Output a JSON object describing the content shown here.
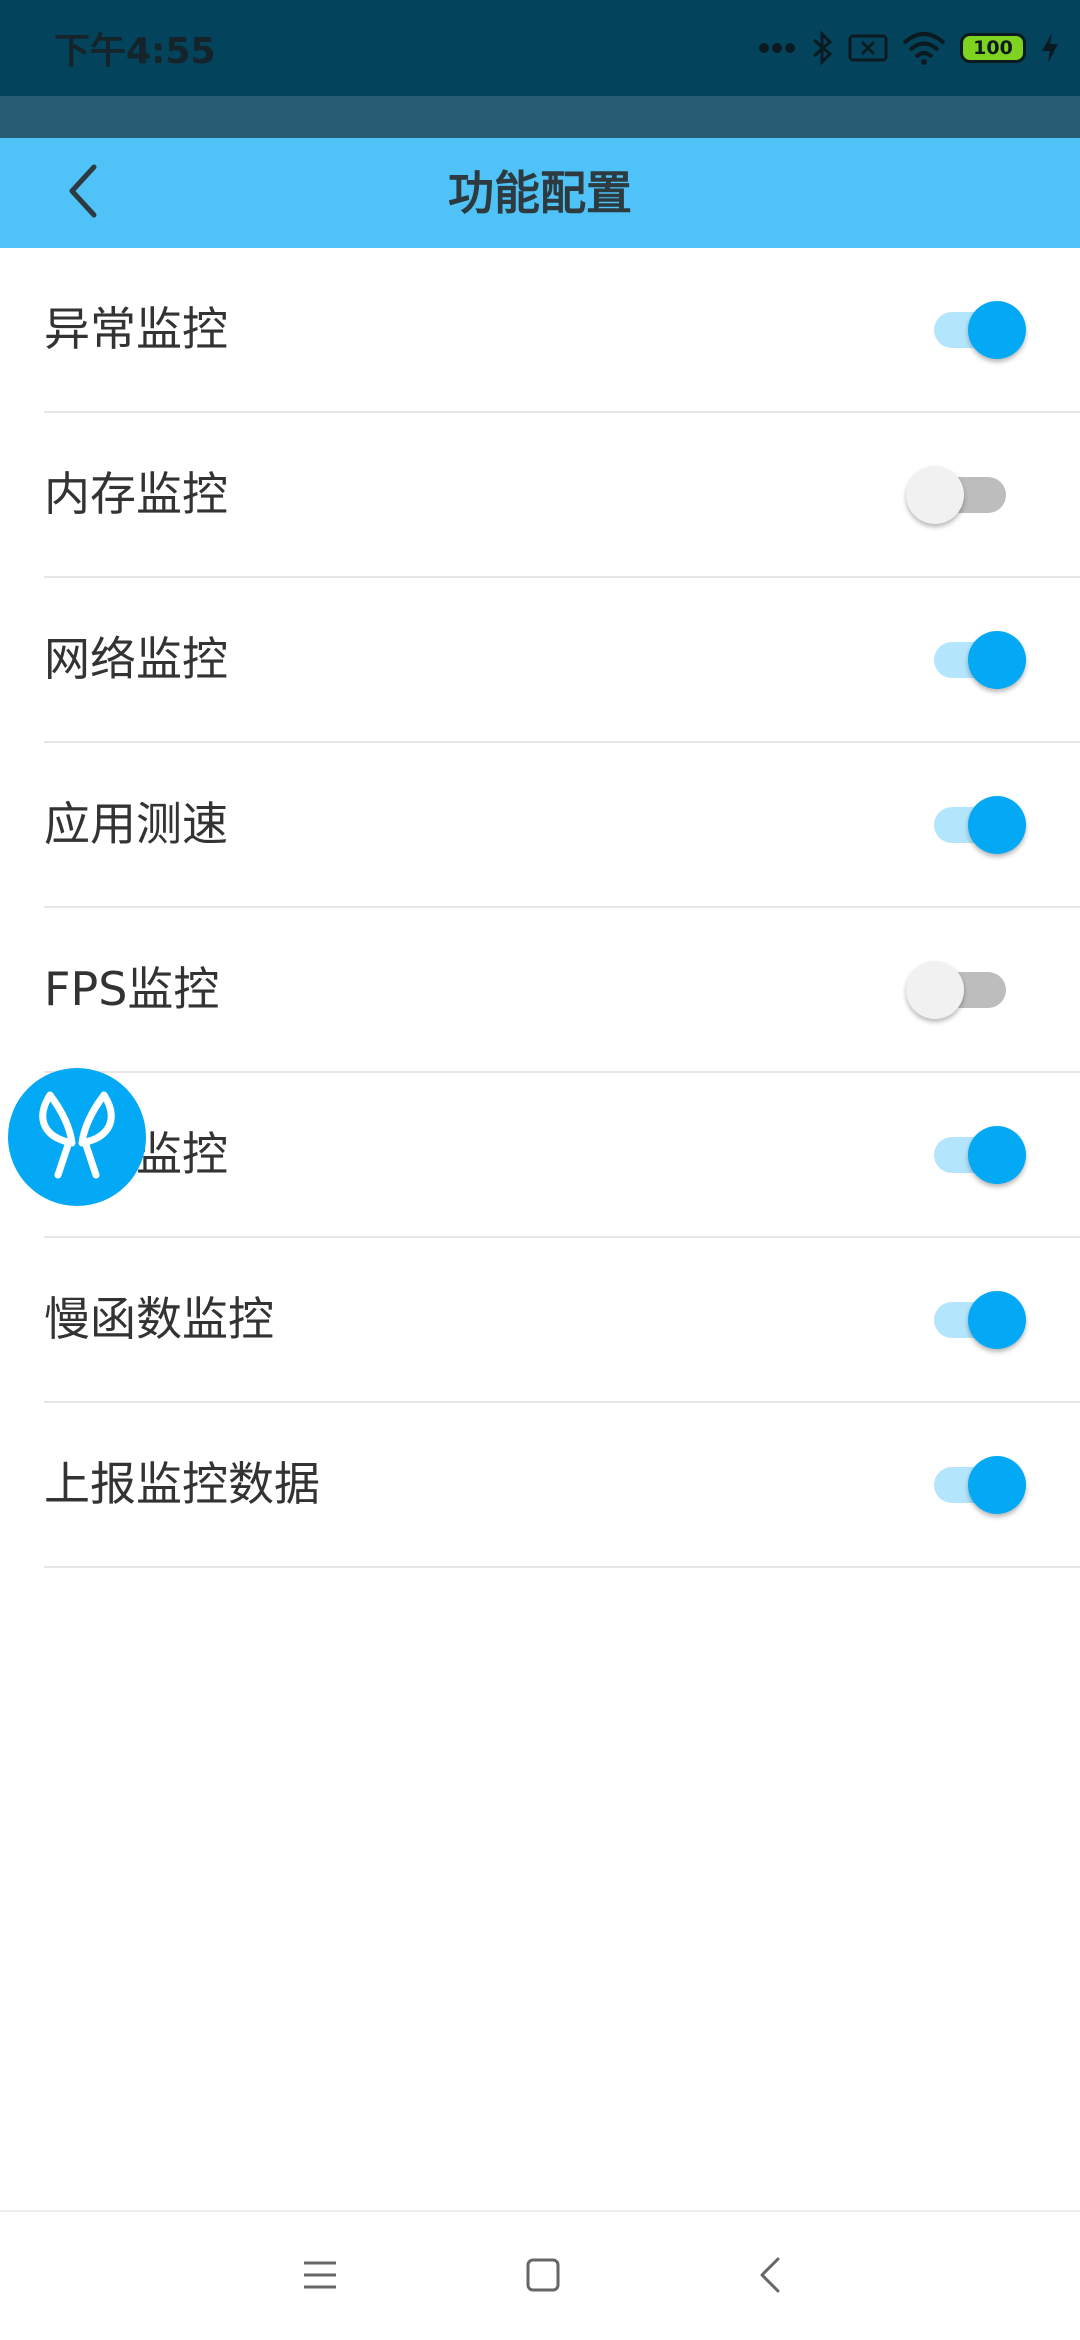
{
  "status_bar": {
    "time": "下午4:55",
    "battery": "100",
    "icons": [
      "more-dots-icon",
      "bluetooth-icon",
      "sim-missing-icon",
      "wifi-icon",
      "battery-icon",
      "charging-icon"
    ]
  },
  "app_bar": {
    "title": "功能配置",
    "background": "#4fc3f7"
  },
  "settings": [
    {
      "label": "异常监控",
      "enabled": true
    },
    {
      "label": "内存监控",
      "enabled": false
    },
    {
      "label": "网络监控",
      "enabled": true
    },
    {
      "label": "应用测速",
      "enabled": true
    },
    {
      "label": "FPS监控",
      "enabled": false
    },
    {
      "label": "卡顿监控",
      "enabled": true
    },
    {
      "label": "慢函数监控",
      "enabled": true
    },
    {
      "label": "上报监控数据",
      "enabled": true
    }
  ],
  "colors": {
    "accent": "#03a9f4",
    "status_bar": "#03435b",
    "switch_on_track": "#b3e5fc",
    "switch_off_track": "#bdbdbd"
  },
  "nav_bar": {
    "icons": [
      "menu-icon",
      "home-icon",
      "back-icon"
    ]
  }
}
